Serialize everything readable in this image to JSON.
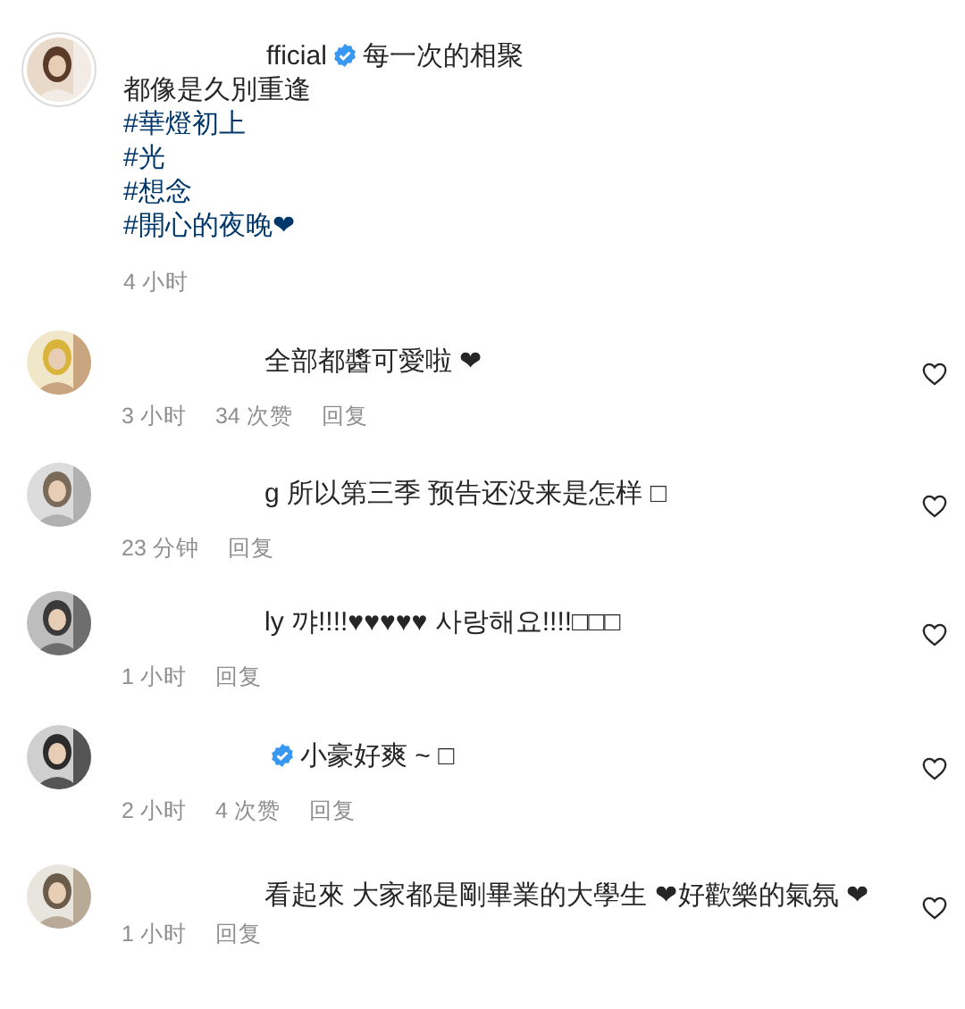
{
  "post": {
    "username": "fficial",
    "verified": true,
    "caption": [
      {
        "kind": "text",
        "text": "每一次的相聚"
      },
      {
        "kind": "text",
        "text": "都像是久別重逢"
      },
      {
        "kind": "hashtag",
        "text": "#華燈初上"
      },
      {
        "kind": "hashtag",
        "text": "#光"
      },
      {
        "kind": "hashtag",
        "text": "#想念"
      },
      {
        "kind": "hashtag",
        "text": "#開心的夜晚❤"
      }
    ],
    "time": "4 小时"
  },
  "comments": [
    {
      "verified": false,
      "text": "全部都醬可愛啦 ❤",
      "time": "3 小时",
      "likes": "34 次赞",
      "reply": "回复"
    },
    {
      "username": "g",
      "verified": false,
      "text": "所以第三季 预告还没来是怎样 □",
      "time": "23 分钟",
      "reply": "回复"
    },
    {
      "username": "ly",
      "verified": false,
      "text": "꺄!!!!♥♥♥♥♥ 사랑해요!!!!□□□",
      "time": "1 小时",
      "reply": "回复"
    },
    {
      "verified": true,
      "text": "小豪好爽 ~ □",
      "time": "2 小时",
      "likes": "4 次赞",
      "reply": "回复"
    },
    {
      "verified": false,
      "text": "看起來 大家都是剛畢業的大學生 ❤好歡樂的氣氛 ❤",
      "time": "1 小时",
      "reply": "回复"
    }
  ]
}
